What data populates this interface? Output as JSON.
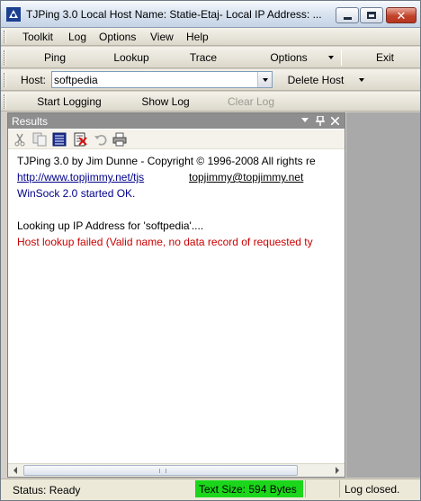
{
  "window": {
    "title": "TJPing 3.0   Local Host Name:  Statie-Etaj-   Local IP Address:  ..."
  },
  "menu": {
    "items": [
      "Toolkit",
      "Log",
      "Options",
      "View",
      "Help"
    ]
  },
  "toolbar": {
    "ping_label": "Ping",
    "lookup_label": "Lookup",
    "trace_label": "Trace",
    "options_label": "Options",
    "exit_label": "Exit"
  },
  "hostbar": {
    "host_label": "Host:",
    "host_value": "softpedia",
    "delete_host_label": "Delete Host"
  },
  "logbar": {
    "start_logging_label": "Start Logging",
    "show_log_label": "Show Log",
    "clear_log_label": "Clear Log"
  },
  "results": {
    "title": "Results",
    "lines": {
      "copyright": "TJPing 3.0 by Jim Dunne - Copyright © 1996-2008  All rights re",
      "url": "http://www.topjimmy.net/tjs",
      "email": "topjimmy@topjimmy.net",
      "winsock": "WinSock 2.0  started OK.",
      "lookup": "Looking up IP Address for 'softpedia'....",
      "error": "Host lookup failed (Valid name, no data record of requested ty"
    }
  },
  "statusbar": {
    "status": "Status: Ready",
    "text_size": "Text Size: 594 Bytes",
    "log_status": "Log closed."
  },
  "colors": {
    "text_size_bg": "#1bd61b",
    "link_blue": "#00008b",
    "error_red": "#cc0000",
    "panel_header": "#8e8e8e"
  },
  "icons": [
    "app-icon",
    "cut-icon",
    "copy-icon",
    "select-all-icon",
    "delete-icon",
    "undo-icon",
    "print-icon",
    "dropdown-icon",
    "pin-icon",
    "close-icon"
  ]
}
